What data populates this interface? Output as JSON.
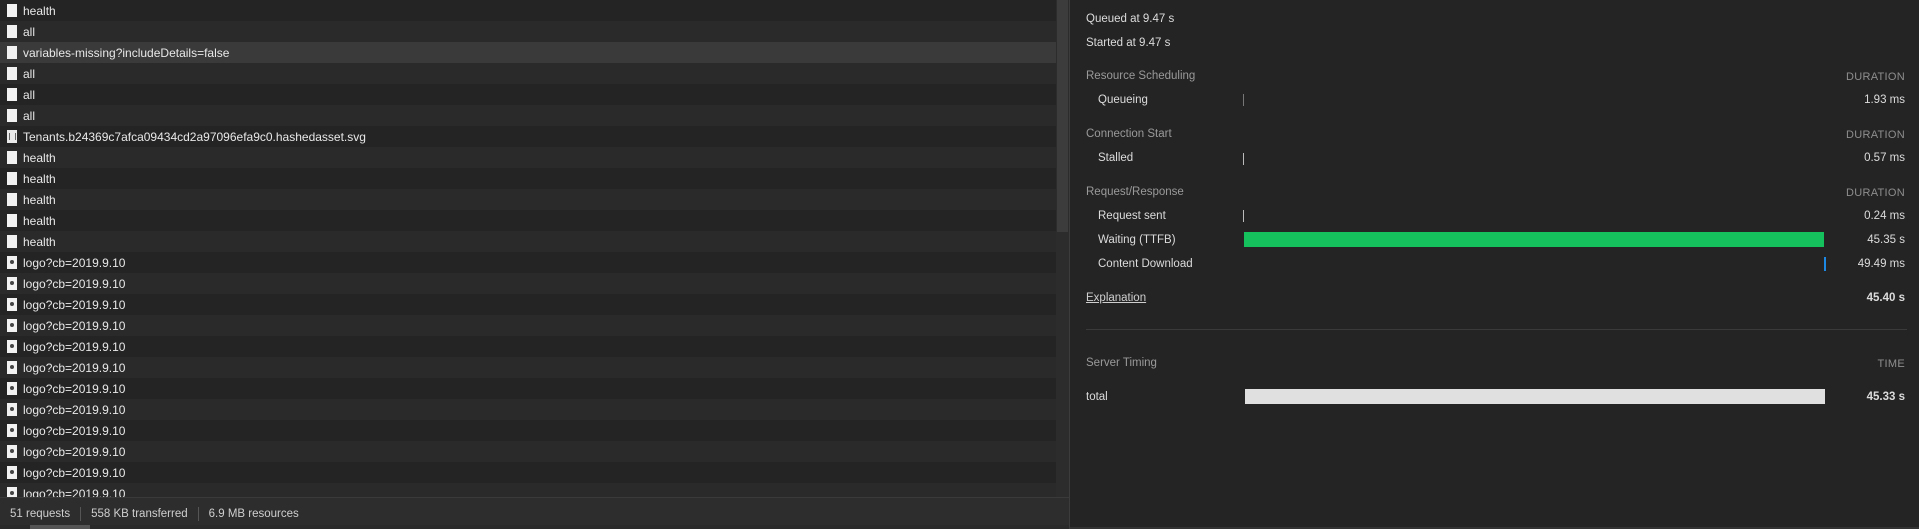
{
  "requests": [
    {
      "name": "health",
      "icon": "document-icon"
    },
    {
      "name": "all",
      "icon": "document-icon"
    },
    {
      "name": "variables-missing?includeDetails=false",
      "icon": "document-icon",
      "selected": true
    },
    {
      "name": "all",
      "icon": "document-icon"
    },
    {
      "name": "all",
      "icon": "document-icon"
    },
    {
      "name": "all",
      "icon": "document-icon"
    },
    {
      "name": "Tenants.b24369c7afca09434cd2a97096efa9c0.hashedasset.svg",
      "icon": "svg-file-icon"
    },
    {
      "name": "health",
      "icon": "document-icon"
    },
    {
      "name": "health",
      "icon": "document-icon"
    },
    {
      "name": "health",
      "icon": "document-icon"
    },
    {
      "name": "health",
      "icon": "document-icon"
    },
    {
      "name": "health",
      "icon": "document-icon"
    },
    {
      "name": "logo?cb=2019.9.10",
      "icon": "image-file-icon"
    },
    {
      "name": "logo?cb=2019.9.10",
      "icon": "image-file-icon"
    },
    {
      "name": "logo?cb=2019.9.10",
      "icon": "image-file-icon"
    },
    {
      "name": "logo?cb=2019.9.10",
      "icon": "image-file-icon"
    },
    {
      "name": "logo?cb=2019.9.10",
      "icon": "image-file-icon"
    },
    {
      "name": "logo?cb=2019.9.10",
      "icon": "image-file-icon"
    },
    {
      "name": "logo?cb=2019.9.10",
      "icon": "image-file-icon"
    },
    {
      "name": "logo?cb=2019.9.10",
      "icon": "image-file-icon"
    },
    {
      "name": "logo?cb=2019.9.10",
      "icon": "image-file-icon"
    },
    {
      "name": "logo?cb=2019.9.10",
      "icon": "image-file-icon"
    },
    {
      "name": "logo?cb=2019.9.10",
      "icon": "image-file-icon"
    },
    {
      "name": "logo?cb=2019.9.10",
      "icon": "image-file-icon"
    }
  ],
  "status_bar": {
    "requests": "51 requests",
    "transferred": "558 KB transferred",
    "resources": "6.9 MB resources"
  },
  "timing": {
    "queued_at": "Queued at 9.47 s",
    "started_at": "Started at 9.47 s",
    "resource_scheduling": {
      "title": "Resource Scheduling",
      "header": "DURATION",
      "rows": [
        {
          "label": "Queueing",
          "value": "1.93 ms"
        }
      ]
    },
    "connection_start": {
      "title": "Connection Start",
      "header": "DURATION",
      "rows": [
        {
          "label": "Stalled",
          "value": "0.57 ms"
        }
      ]
    },
    "request_response": {
      "title": "Request/Response",
      "header": "DURATION",
      "rows": [
        {
          "label": "Request sent",
          "value": "0.24 ms"
        },
        {
          "label": "Waiting (TTFB)",
          "value": "45.35 s"
        },
        {
          "label": "Content Download",
          "value": "49.49 ms"
        }
      ]
    },
    "explanation_label": "Explanation",
    "total": "45.40 s",
    "server_timing": {
      "title": "Server Timing",
      "header": "TIME",
      "rows": [
        {
          "label": "total",
          "value": "45.33 s"
        }
      ]
    }
  },
  "colors": {
    "ttfb_bar": "#15c15d",
    "download_tick": "#1e88e5",
    "server_total_bar": "#e0e0e0"
  }
}
